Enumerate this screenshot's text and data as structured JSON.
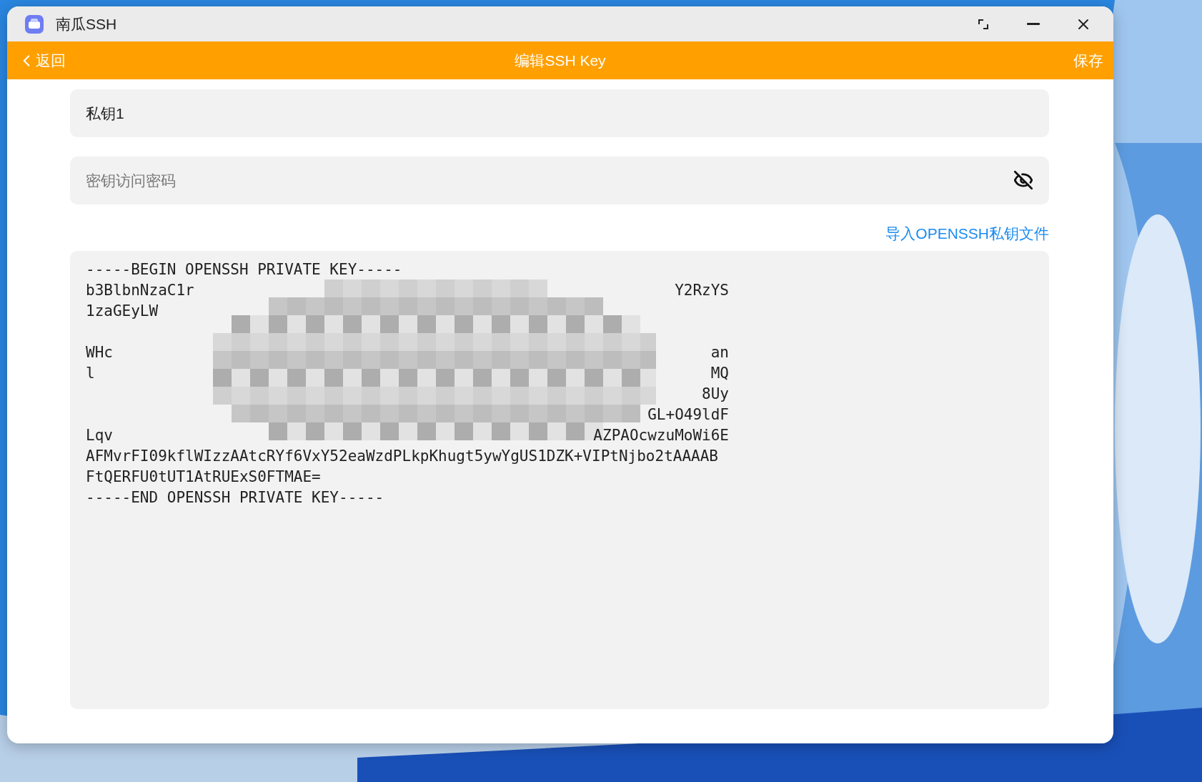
{
  "window": {
    "title": "南瓜SSH"
  },
  "nav": {
    "back": "返回",
    "title": "编辑SSH Key",
    "save": "保存"
  },
  "name_field": {
    "value": "私钥1"
  },
  "password_field": {
    "placeholder": "密钥访问密码",
    "visible": false
  },
  "import_link": "导入OPENSSH私钥文件",
  "key_lines": [
    {
      "kind": "text",
      "left": "-----BEGIN OPENSSH PRIVATE KEY-----"
    },
    {
      "kind": "text",
      "left": "b3BlbnNzaC1r",
      "right": "Y2RzYS"
    },
    {
      "kind": "text",
      "left": "1zaGEyLW"
    },
    {
      "kind": "covered"
    },
    {
      "kind": "text",
      "left": "WHc",
      "right": "an"
    },
    {
      "kind": "text",
      "left": "l",
      "right": "MQ"
    },
    {
      "kind": "text",
      "right": "8Uy"
    },
    {
      "kind": "text",
      "right": "GL+O49ldF"
    },
    {
      "kind": "text",
      "left": "Lqv",
      "right": "AZPAOcwzuMoWi6E"
    },
    {
      "kind": "text",
      "left": "AFMvrFI09kflWIzzAAtcRYf6VxY52eaWzdPLkpKhugt5ywYgUS1DZK+VIPtNjbo2tAAAAB"
    },
    {
      "kind": "text",
      "left": "FtQERFU0tUT1AtRUExS0FTMAE="
    },
    {
      "kind": "text",
      "left": "-----END OPENSSH PRIVATE KEY-----"
    }
  ]
}
